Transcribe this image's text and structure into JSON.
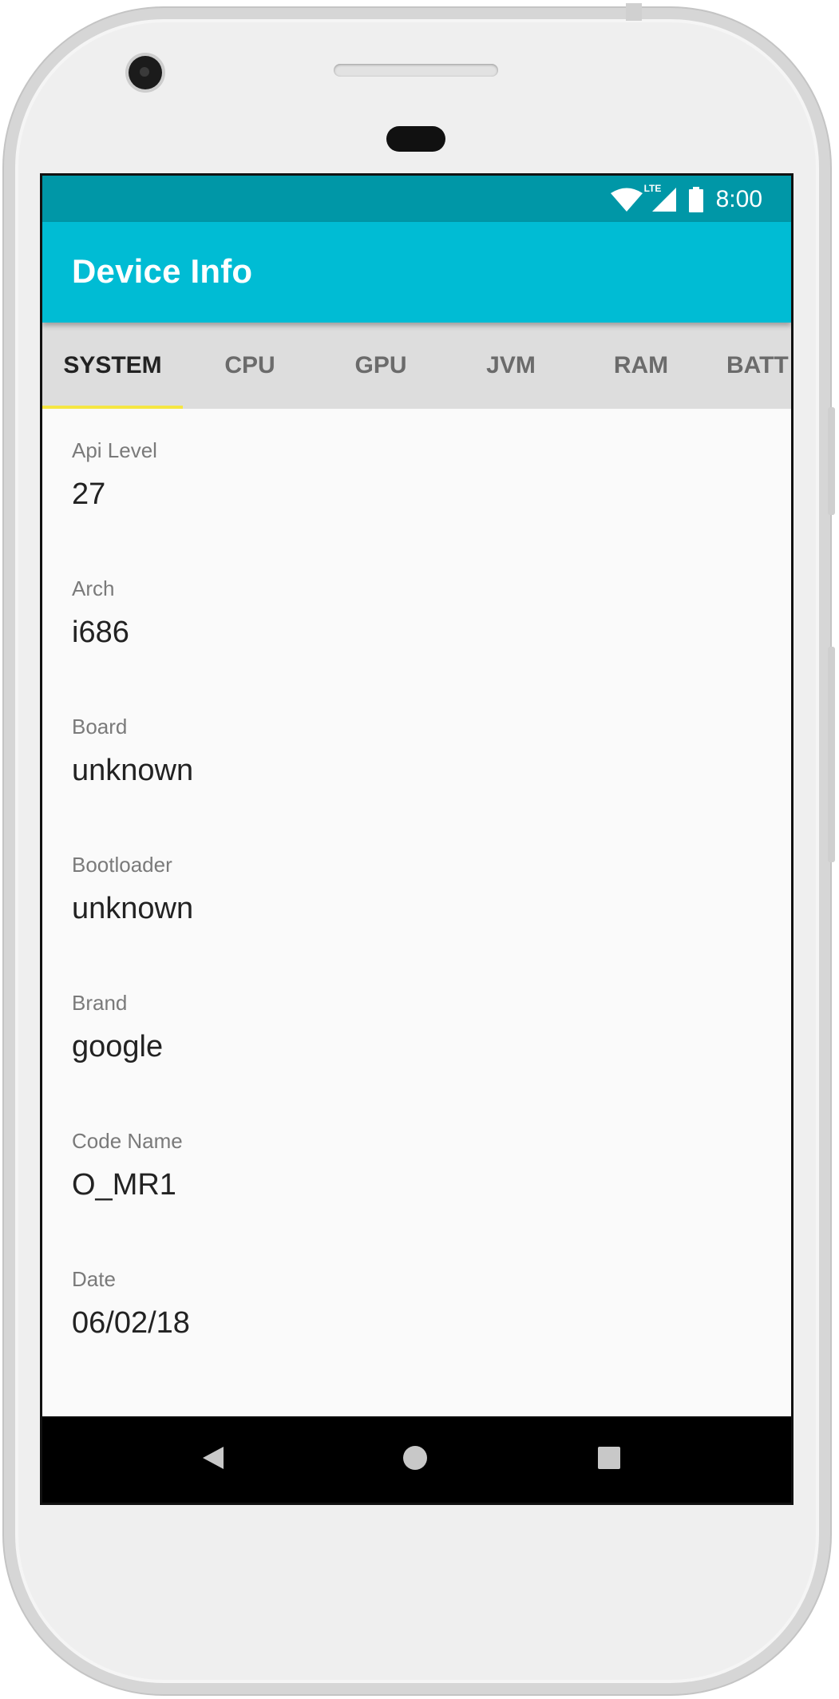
{
  "app": {
    "title": "Device Info"
  },
  "status_bar": {
    "time": "8:00",
    "network": "LTE"
  },
  "tabs": [
    {
      "label": "SYSTEM",
      "active": true
    },
    {
      "label": "CPU",
      "active": false
    },
    {
      "label": "GPU",
      "active": false
    },
    {
      "label": "JVM",
      "active": false
    },
    {
      "label": "RAM",
      "active": false
    },
    {
      "label": "BATT",
      "active": false
    }
  ],
  "items": [
    {
      "label": "Api Level",
      "value": "27"
    },
    {
      "label": "Arch",
      "value": "i686"
    },
    {
      "label": "Board",
      "value": "unknown"
    },
    {
      "label": "Bootloader",
      "value": "unknown"
    },
    {
      "label": "Brand",
      "value": "google"
    },
    {
      "label": "Code Name",
      "value": "O_MR1"
    },
    {
      "label": "Date",
      "value": "06/02/18"
    }
  ],
  "colors": {
    "status_bar": "#0097a7",
    "app_bar": "#00bcd4",
    "tab_bar": "#dddddd",
    "tab_indicator": "#f5e642",
    "background": "#fafafa"
  },
  "nav_icons": [
    "back-icon",
    "home-icon",
    "recents-icon"
  ]
}
